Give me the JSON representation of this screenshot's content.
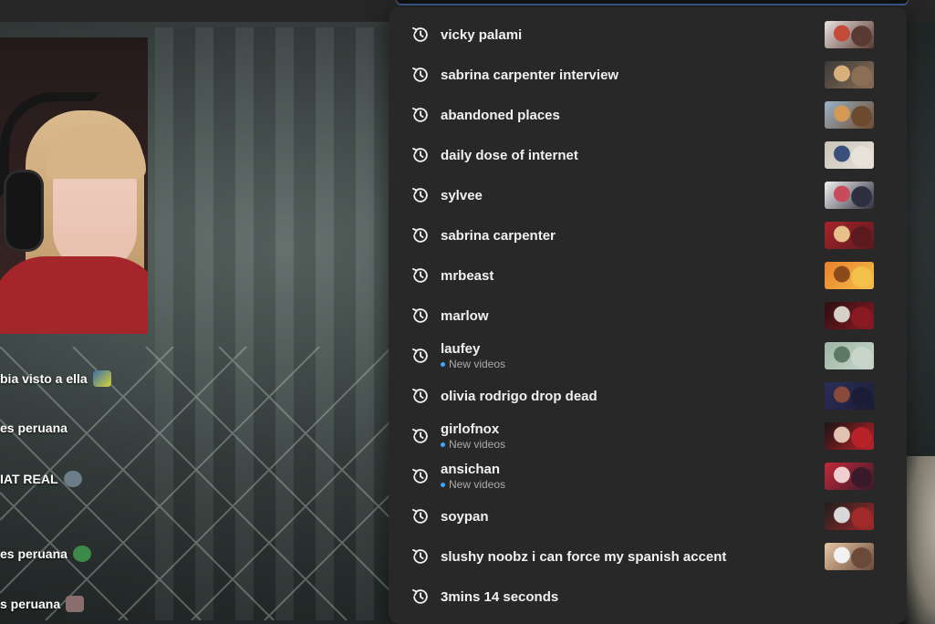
{
  "chat": {
    "lines": [
      {
        "text": "bia visto a ella",
        "emote_color": "#d8d23a"
      },
      {
        "text": "es peruana",
        "emote_color": ""
      },
      {
        "text": "IAT REAL",
        "emote_color": "#6b7d88"
      },
      {
        "text": "es peruana",
        "emote_color": "#3c8a4a"
      },
      {
        "text": "s peruana",
        "emote_color": "#8a6d6d"
      }
    ]
  },
  "search_history": {
    "items": [
      {
        "query": "vicky palami",
        "sub": "",
        "thumb_colors": [
          "#e9e2de",
          "#c44a3a",
          "#5a3b33"
        ]
      },
      {
        "query": "sabrina carpenter interview",
        "sub": "",
        "thumb_colors": [
          "#3a3a3a",
          "#d7b07a",
          "#8a6e55"
        ]
      },
      {
        "query": "abandoned places",
        "sub": "",
        "thumb_colors": [
          "#9ab3c9",
          "#d49a55",
          "#6b4a2e"
        ]
      },
      {
        "query": "daily dose of internet",
        "sub": "",
        "thumb_colors": [
          "#c9c3b8",
          "#3a4f7a",
          "#e8e3da"
        ]
      },
      {
        "query": "sylvee",
        "sub": "",
        "thumb_colors": [
          "#f2f2f2",
          "#c94a5a",
          "#2f2f3f"
        ]
      },
      {
        "query": "sabrina carpenter",
        "sub": "",
        "thumb_colors": [
          "#a7242a",
          "#e8c08a",
          "#5b1a1e"
        ]
      },
      {
        "query": "mrbeast",
        "sub": "",
        "thumb_colors": [
          "#e9802a",
          "#8a4a1a",
          "#f3c04a"
        ]
      },
      {
        "query": "marlow",
        "sub": "",
        "thumb_colors": [
          "#2a0f12",
          "#d6d0ca",
          "#8a1a22"
        ]
      },
      {
        "query": "laufey",
        "sub": "New videos",
        "thumb_colors": [
          "#9fb6a4",
          "#5c7a63",
          "#c7d6c9"
        ]
      },
      {
        "query": "olivia rodrigo drop dead",
        "sub": "",
        "thumb_colors": [
          "#2b2f5a",
          "#8a4a3a",
          "#1a1d35"
        ]
      },
      {
        "query": "girlofnox",
        "sub": "New videos",
        "thumb_colors": [
          "#1a1414",
          "#e2c2b0",
          "#b8232a"
        ]
      },
      {
        "query": "ansichan",
        "sub": "New videos",
        "thumb_colors": [
          "#c22a3a",
          "#f0d0d0",
          "#3a1a2a"
        ]
      },
      {
        "query": "soypan",
        "sub": "",
        "thumb_colors": [
          "#1f1f1f",
          "#d8d8d8",
          "#a02a2a"
        ]
      },
      {
        "query": "slushy noobz i can force my spanish accent",
        "sub": "",
        "thumb_colors": [
          "#e8c7a5",
          "#f2f2f2",
          "#6a4a3a"
        ]
      },
      {
        "query": "3mins 14 seconds",
        "sub": "",
        "thumb_colors": []
      }
    ]
  },
  "icons": {
    "history": "history-icon"
  },
  "colors": {
    "dropdown_bg": "#282828",
    "text_primary": "#f1f1f1",
    "text_secondary": "#aaaaaa",
    "new_dot": "#3ea6ff"
  }
}
